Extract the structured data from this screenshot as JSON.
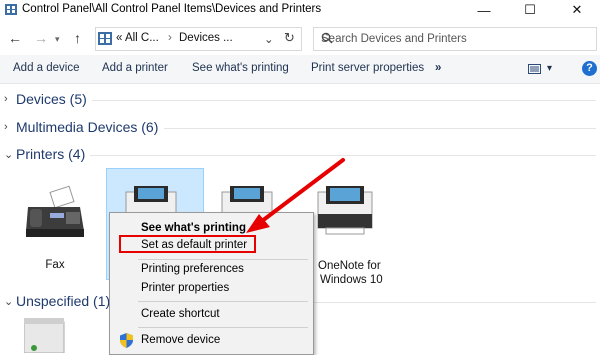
{
  "window": {
    "title": "Control Panel\\All Control Panel Items\\Devices and Printers",
    "minimize_glyph": "—",
    "maximize_glyph": "☐",
    "close_glyph": "✕"
  },
  "nav": {
    "back_glyph": "←",
    "forward_glyph": "→",
    "up_glyph": "↑",
    "address_seg1": "« All C...",
    "address_sep": "›",
    "address_seg2": "Devices ...",
    "dropdown_glyph": "⌄",
    "refresh_glyph": "↻",
    "search_placeholder": "Search Devices and Printers"
  },
  "toolbar": {
    "add_device": "Add a device",
    "add_printer": "Add a printer",
    "see_printing": "See what's printing",
    "print_server": "Print server properties",
    "more": "»",
    "view_dropdown": "▾",
    "help": "?"
  },
  "groups": {
    "devices": "Devices (5)",
    "multimedia": "Multimedia Devices (6)",
    "printers": "Printers (4)",
    "unspecified": "Unspecified (1)"
  },
  "printers": [
    {
      "name": "Fax"
    },
    {
      "name": "OneNote for",
      "name2": "Windows 10"
    }
  ],
  "context_menu": {
    "see_printing": "See what's printing",
    "set_default": "Set as default printer",
    "preferences": "Printing preferences",
    "properties": "Printer properties",
    "create_shortcut": "Create shortcut",
    "remove_device": "Remove device"
  },
  "colors": {
    "highlight_box": "#e60000",
    "arrow": "#e60000",
    "selection": "#cce8ff"
  }
}
